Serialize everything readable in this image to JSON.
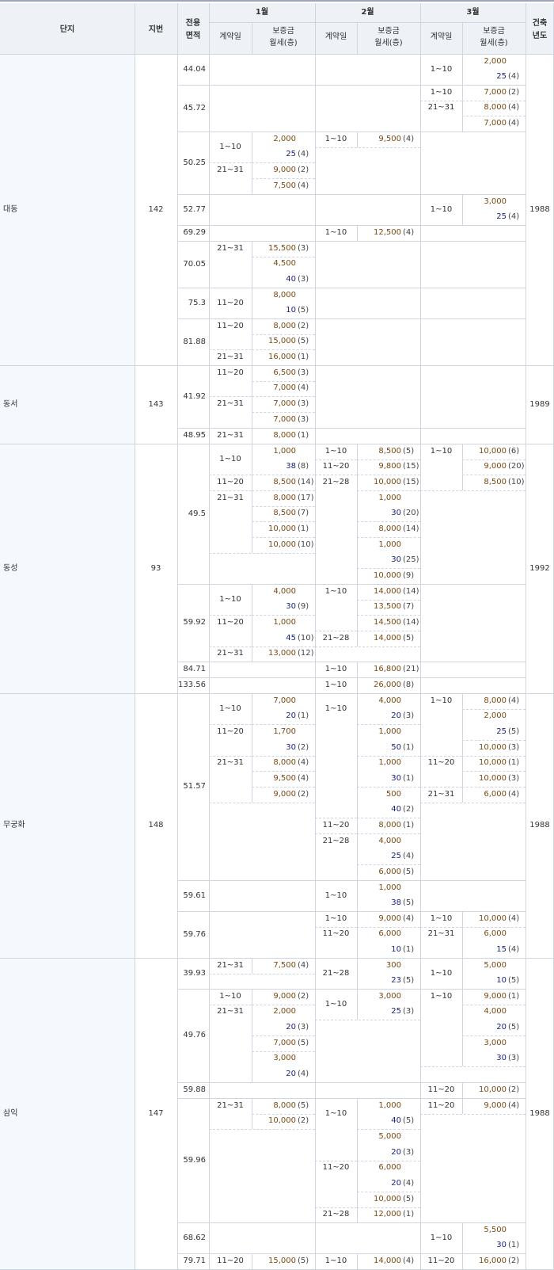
{
  "colors": {
    "header_background": "#eef2f7",
    "complex_column_background": "#f5f8fc",
    "grid_line": "#cfd6e0",
    "deposit_text": "#7a4a12",
    "rent_text": "#1a237e"
  },
  "header": {
    "complex": "단지",
    "lot_number": "지번",
    "area_line1": "전용",
    "area_line2": "면적",
    "months": [
      "1월",
      "2월",
      "3월"
    ],
    "contract_day": "계약일",
    "deposit_line1": "보증금",
    "deposit_line2": "월세(층)",
    "built_year_line1": "건축",
    "built_year_line2": "년도"
  },
  "complexes": [
    {
      "name": "대동",
      "lot": "142",
      "year": "1988",
      "areas": [
        {
          "area": "44.04",
          "months": [
            [],
            [],
            [
              {
                "day": "1~10",
                "deposit": "2,000",
                "rent": "25",
                "floor": "(4)"
              }
            ]
          ]
        },
        {
          "area": "45.72",
          "months": [
            [],
            [],
            [
              {
                "day": "1~10",
                "deposit": "7,000",
                "floor": "(2)"
              },
              {
                "day": "21~31",
                "deposit": "8,000",
                "floor": "(4)"
              },
              {
                "deposit": "7,000",
                "floor": "(4)"
              }
            ]
          ]
        },
        {
          "area": "50.25",
          "months": [
            [
              {
                "day": "1~10",
                "deposit": "2,000",
                "rent": "25",
                "floor": "(4)"
              },
              {
                "day": "21~31",
                "deposit": "9,000",
                "floor": "(2)"
              },
              {
                "deposit": "7,500",
                "floor": "(4)"
              }
            ],
            [
              {
                "day": "1~10",
                "deposit": "9,500",
                "floor": "(4)"
              }
            ],
            []
          ]
        },
        {
          "area": "52.77",
          "months": [
            [],
            [],
            [
              {
                "day": "1~10",
                "deposit": "3,000",
                "rent": "25",
                "floor": "(4)"
              }
            ]
          ]
        },
        {
          "area": "69.29",
          "months": [
            [],
            [
              {
                "day": "1~10",
                "deposit": "12,500",
                "floor": "(4)"
              }
            ],
            []
          ]
        },
        {
          "area": "70.05",
          "months": [
            [
              {
                "day": "21~31",
                "deposit": "15,500",
                "floor": "(3)"
              },
              {
                "deposit": "4,500",
                "rent": "40",
                "floor": "(3)"
              }
            ],
            [],
            []
          ]
        },
        {
          "area": "75.3",
          "months": [
            [
              {
                "day": "11~20",
                "deposit": "8,000",
                "rent": "10",
                "floor": "(5)"
              }
            ],
            [],
            []
          ]
        },
        {
          "area": "81.88",
          "months": [
            [
              {
                "day": "11~20",
                "deposit": "8,000",
                "floor": "(2)"
              },
              {
                "deposit": "15,000",
                "floor": "(5)"
              },
              {
                "day": "21~31",
                "deposit": "16,000",
                "floor": "(1)"
              }
            ],
            [],
            []
          ]
        }
      ]
    },
    {
      "name": "동서",
      "lot": "143",
      "year": "1989",
      "areas": [
        {
          "area": "41.92",
          "months": [
            [
              {
                "day": "11~20",
                "deposit": "6,500",
                "floor": "(3)"
              },
              {
                "deposit": "7,000",
                "floor": "(4)"
              },
              {
                "day": "21~31",
                "deposit": "7,000",
                "floor": "(3)"
              },
              {
                "deposit": "7,000",
                "floor": "(3)"
              }
            ],
            [],
            []
          ]
        },
        {
          "area": "48.95",
          "months": [
            [
              {
                "day": "21~31",
                "deposit": "8,000",
                "floor": "(1)"
              }
            ],
            [],
            []
          ]
        }
      ]
    },
    {
      "name": "동성",
      "lot": "93",
      "year": "1992",
      "areas": [
        {
          "area": "49.5",
          "months": [
            [
              {
                "day": "1~10",
                "deposit": "1,000",
                "rent": "38",
                "floor": "(8)"
              },
              {
                "day": "11~20",
                "deposit": "8,500",
                "floor": "(14)"
              },
              {
                "day": "21~31",
                "deposit": "8,000",
                "floor": "(17)"
              },
              {
                "deposit": "8,500",
                "floor": "(7)"
              },
              {
                "deposit": "10,000",
                "floor": "(1)"
              },
              {
                "deposit": "10,000",
                "floor": "(10)"
              }
            ],
            [
              {
                "day": "1~10",
                "deposit": "8,500",
                "floor": "(5)"
              },
              {
                "day": "11~20",
                "deposit": "9,800",
                "floor": "(15)"
              },
              {
                "day": "21~28",
                "deposit": "10,000",
                "floor": "(15)"
              },
              {
                "deposit": "1,000",
                "rent": "30",
                "floor": "(20)"
              },
              {
                "deposit": "8,000",
                "floor": "(14)"
              },
              {
                "deposit": "1,000",
                "rent": "30",
                "floor": "(25)"
              },
              {
                "deposit": "10,000",
                "floor": "(9)"
              }
            ],
            [
              {
                "day": "1~10",
                "deposit": "10,000",
                "floor": "(6)"
              },
              {
                "deposit": "9,000",
                "floor": "(20)"
              },
              {
                "deposit": "8,500",
                "floor": "(10)"
              }
            ]
          ]
        },
        {
          "area": "59.92",
          "months": [
            [
              {
                "day": "1~10",
                "deposit": "4,000",
                "rent": "30",
                "floor": "(9)"
              },
              {
                "day": "11~20",
                "deposit": "1,000",
                "rent": "45",
                "floor": "(10)"
              },
              {
                "day": "21~31",
                "deposit": "13,000",
                "floor": "(12)"
              }
            ],
            [
              {
                "day": "1~10",
                "deposit": "14,000",
                "floor": "(14)"
              },
              {
                "deposit": "13,500",
                "floor": "(7)"
              },
              {
                "deposit": "14,500",
                "floor": "(14)"
              },
              {
                "day": "21~28",
                "deposit": "14,000",
                "floor": "(5)"
              }
            ],
            []
          ]
        },
        {
          "area": "84.71",
          "months": [
            [],
            [
              {
                "day": "1~10",
                "deposit": "16,800",
                "floor": "(21)"
              }
            ],
            []
          ]
        },
        {
          "area": "133.56",
          "months": [
            [],
            [
              {
                "day": "1~10",
                "deposit": "26,000",
                "floor": "(8)"
              }
            ],
            []
          ]
        }
      ]
    },
    {
      "name": "무궁화",
      "lot": "148",
      "year": "1988",
      "areas": [
        {
          "area": "51.57",
          "months": [
            [
              {
                "day": "1~10",
                "deposit": "7,000",
                "rent": "20",
                "floor": "(1)"
              },
              {
                "day": "11~20",
                "deposit": "1,700",
                "rent": "30",
                "floor": "(2)"
              },
              {
                "day": "21~31",
                "deposit": "8,000",
                "floor": "(4)"
              },
              {
                "deposit": "9,500",
                "floor": "(4)"
              },
              {
                "deposit": "9,000",
                "floor": "(2)"
              }
            ],
            [
              {
                "day": "1~10",
                "deposit": "4,000",
                "rent": "20",
                "floor": "(3)"
              },
              {
                "deposit": "1,000",
                "rent": "50",
                "floor": "(1)"
              },
              {
                "deposit": "1,000",
                "rent": "30",
                "floor": "(1)"
              },
              {
                "deposit": "500",
                "rent": "40",
                "floor": "(2)"
              },
              {
                "day": "11~20",
                "deposit": "8,000",
                "floor": "(1)"
              },
              {
                "day": "21~28",
                "deposit": "4,000",
                "rent": "25",
                "floor": "(4)"
              },
              {
                "deposit": "6,000",
                "floor": "(5)"
              }
            ],
            [
              {
                "day": "1~10",
                "deposit": "8,000",
                "floor": "(4)"
              },
              {
                "deposit": "2,000",
                "rent": "25",
                "floor": "(5)"
              },
              {
                "deposit": "10,000",
                "floor": "(3)"
              },
              {
                "day": "11~20",
                "deposit": "10,000",
                "floor": "(1)"
              },
              {
                "deposit": "10,000",
                "floor": "(3)"
              },
              {
                "day": "21~31",
                "deposit": "6,000",
                "floor": "(4)"
              }
            ]
          ]
        },
        {
          "area": "59.61",
          "months": [
            [],
            [
              {
                "day": "1~10",
                "deposit": "1,000",
                "rent": "38",
                "floor": "(5)"
              }
            ],
            []
          ]
        },
        {
          "area": "59.76",
          "months": [
            [],
            [
              {
                "day": "1~10",
                "deposit": "9,000",
                "floor": "(4)"
              },
              {
                "day": "11~20",
                "deposit": "6,000",
                "rent": "10",
                "floor": "(1)"
              }
            ],
            [
              {
                "day": "1~10",
                "deposit": "10,000",
                "floor": "(4)"
              },
              {
                "day": "21~31",
                "deposit": "6,000",
                "rent": "15",
                "floor": "(4)"
              }
            ]
          ]
        }
      ]
    },
    {
      "name": "삼익",
      "lot": "147",
      "year": "1988",
      "areas": [
        {
          "area": "39.93",
          "months": [
            [
              {
                "day": "21~31",
                "deposit": "7,500",
                "floor": "(4)"
              }
            ],
            [
              {
                "day": "21~28",
                "deposit": "300",
                "rent": "23",
                "floor": "(5)"
              }
            ],
            [
              {
                "day": "1~10",
                "deposit": "5,000",
                "rent": "10",
                "floor": "(5)"
              }
            ]
          ]
        },
        {
          "area": "49.76",
          "months": [
            [
              {
                "day": "1~10",
                "deposit": "9,000",
                "floor": "(2)"
              },
              {
                "day": "21~31",
                "deposit": "2,000",
                "rent": "20",
                "floor": "(3)"
              },
              {
                "deposit": "7,000",
                "floor": "(5)"
              },
              {
                "deposit": "3,000",
                "rent": "20",
                "floor": "(4)"
              }
            ],
            [
              {
                "day": "1~10",
                "deposit": "3,000",
                "rent": "25",
                "floor": "(3)"
              }
            ],
            [
              {
                "day": "1~10",
                "deposit": "9,000",
                "floor": "(1)"
              },
              {
                "deposit": "4,000",
                "rent": "20",
                "floor": "(5)"
              },
              {
                "deposit": "3,000",
                "rent": "30",
                "floor": "(3)"
              }
            ]
          ]
        },
        {
          "area": "59.88",
          "months": [
            [],
            [],
            [
              {
                "day": "11~20",
                "deposit": "10,000",
                "floor": "(2)"
              }
            ]
          ]
        },
        {
          "area": "59.96",
          "months": [
            [
              {
                "day": "21~31",
                "deposit": "8,000",
                "floor": "(5)"
              },
              {
                "deposit": "10,000",
                "floor": "(2)"
              }
            ],
            [
              {
                "day": "1~10",
                "deposit": "1,000",
                "rent": "40",
                "floor": "(5)"
              },
              {
                "deposit": "5,000",
                "rent": "20",
                "floor": "(3)"
              },
              {
                "day": "11~20",
                "deposit": "6,000",
                "rent": "20",
                "floor": "(4)"
              },
              {
                "deposit": "10,000",
                "floor": "(5)"
              },
              {
                "day": "21~28",
                "deposit": "12,000",
                "floor": "(1)"
              }
            ],
            [
              {
                "day": "11~20",
                "deposit": "9,000",
                "floor": "(4)"
              }
            ]
          ]
        },
        {
          "area": "68.62",
          "months": [
            [],
            [],
            [
              {
                "day": "1~10",
                "deposit": "5,500",
                "rent": "30",
                "floor": "(1)"
              }
            ]
          ]
        },
        {
          "area": "79.71",
          "months": [
            [
              {
                "day": "11~20",
                "deposit": "15,000",
                "floor": "(5)"
              }
            ],
            [
              {
                "day": "1~10",
                "deposit": "14,000",
                "floor": "(4)"
              }
            ],
            [
              {
                "day": "11~20",
                "deposit": "16,000",
                "floor": "(2)"
              }
            ]
          ]
        }
      ]
    }
  ]
}
